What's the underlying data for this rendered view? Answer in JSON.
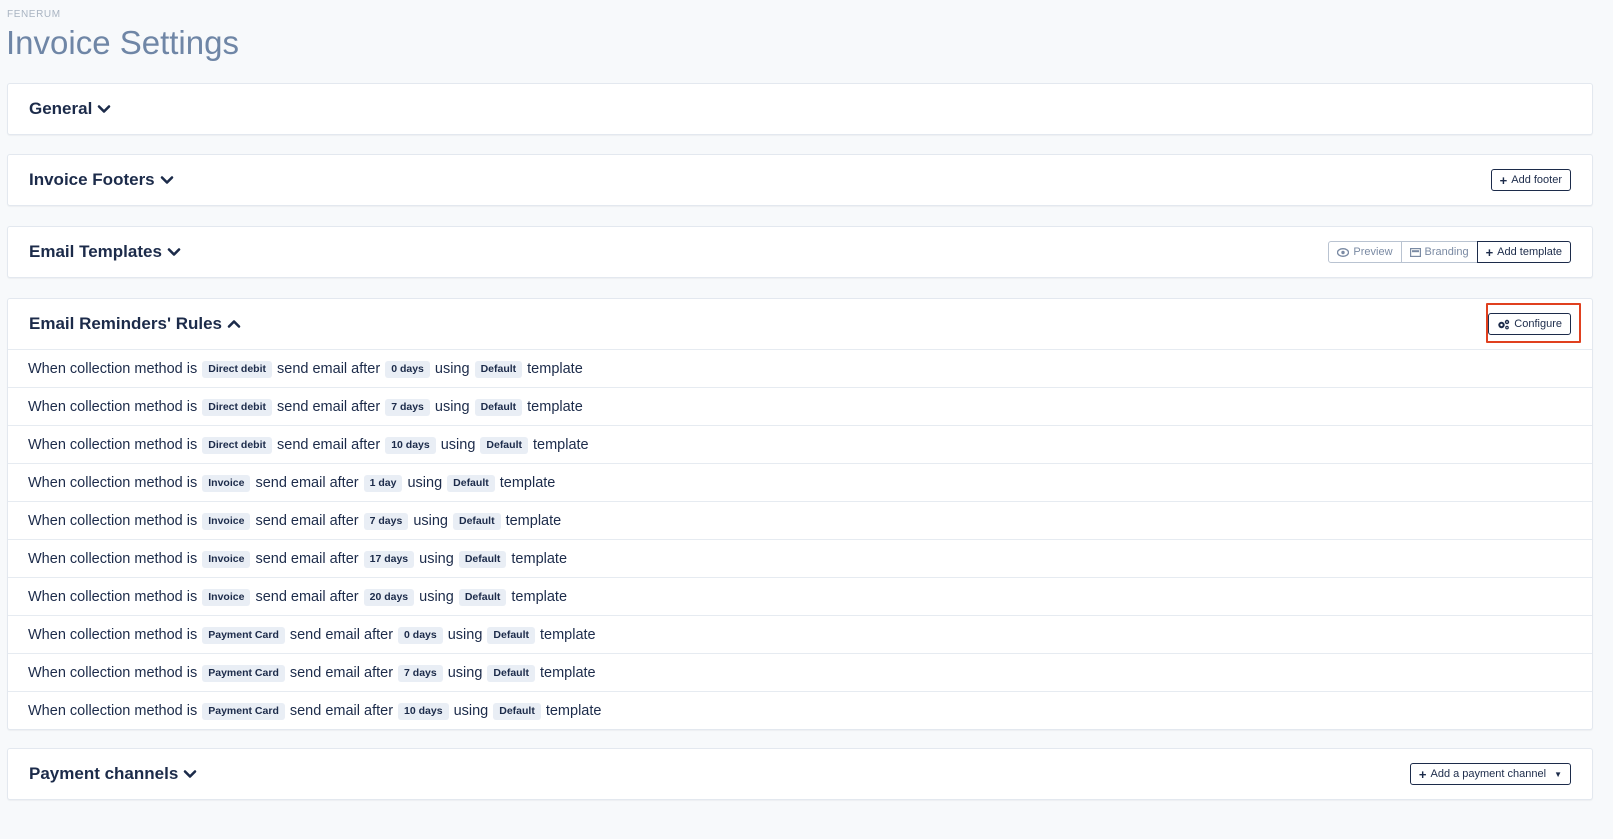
{
  "brand": "FENERUM",
  "page_title": "Invoice Settings",
  "accent_color": "#1c2b4a",
  "highlight_color": "#e0401f",
  "sections": {
    "general": {
      "title": "General",
      "expanded": false,
      "icon": "chevron-down-icon"
    },
    "invoice_footers": {
      "title": "Invoice Footers",
      "expanded": false,
      "add_label": "Add footer"
    },
    "email_templates": {
      "title": "Email Templates",
      "expanded": false,
      "preview_label": "Preview",
      "branding_label": "Branding",
      "add_label": "Add template"
    },
    "email_reminders": {
      "title": "Email Reminders' Rules",
      "expanded": true,
      "configure_label": "Configure",
      "rules": [
        {
          "prefix": "When collection method is",
          "method": "Direct debit",
          "mid": "send email after",
          "days": "0 days",
          "using": "using",
          "template": "Default",
          "suffix": "template"
        },
        {
          "prefix": "When collection method is",
          "method": "Direct debit",
          "mid": "send email after",
          "days": "7 days",
          "using": "using",
          "template": "Default",
          "suffix": "template"
        },
        {
          "prefix": "When collection method is",
          "method": "Direct debit",
          "mid": "send email after",
          "days": "10 days",
          "using": "using",
          "template": "Default",
          "suffix": "template"
        },
        {
          "prefix": "When collection method is",
          "method": "Invoice",
          "mid": "send email after",
          "days": "1 day",
          "using": "using",
          "template": "Default",
          "suffix": "template"
        },
        {
          "prefix": "When collection method is",
          "method": "Invoice",
          "mid": "send email after",
          "days": "7 days",
          "using": "using",
          "template": "Default",
          "suffix": "template"
        },
        {
          "prefix": "When collection method is",
          "method": "Invoice",
          "mid": "send email after",
          "days": "17 days",
          "using": "using",
          "template": "Default",
          "suffix": "template"
        },
        {
          "prefix": "When collection method is",
          "method": "Invoice",
          "mid": "send email after",
          "days": "20 days",
          "using": "using",
          "template": "Default",
          "suffix": "template"
        },
        {
          "prefix": "When collection method is",
          "method": "Payment Card",
          "mid": "send email after",
          "days": "0 days",
          "using": "using",
          "template": "Default",
          "suffix": "template"
        },
        {
          "prefix": "When collection method is",
          "method": "Payment Card",
          "mid": "send email after",
          "days": "7 days",
          "using": "using",
          "template": "Default",
          "suffix": "template"
        },
        {
          "prefix": "When collection method is",
          "method": "Payment Card",
          "mid": "send email after",
          "days": "10 days",
          "using": "using",
          "template": "Default",
          "suffix": "template"
        }
      ]
    },
    "payment_channels": {
      "title": "Payment channels",
      "expanded": false,
      "add_label": "Add a payment channel"
    }
  }
}
